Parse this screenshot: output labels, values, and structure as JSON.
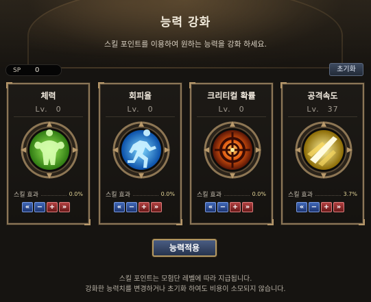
{
  "header": {
    "title": "능력 강화",
    "subtitle": "스킬 포인트를 이용하여 원하는 능력을 강화 하세요."
  },
  "sp": {
    "label": "SP",
    "value": "0"
  },
  "reset_button": "초기화",
  "level_prefix": "Lv.",
  "effect_label": "스킬 효과",
  "cards": [
    {
      "name": "체력",
      "level": "0",
      "effect": "0.0%",
      "icon": "muscle-body-icon",
      "color": "#6fd23a"
    },
    {
      "name": "회피율",
      "level": "0",
      "effect": "0.0%",
      "icon": "running-figure-icon",
      "color": "#2fa8f0"
    },
    {
      "name": "크리티컬 확률",
      "level": "0",
      "effect": "0.0%",
      "icon": "crosshair-target-icon",
      "color": "#f07a1e"
    },
    {
      "name": "공격속도",
      "level": "37",
      "effect": "3.7%",
      "icon": "speed-blade-icon",
      "color": "#f2c62a"
    }
  ],
  "stepper_icons": [
    "double-left-icon",
    "minus-icon",
    "plus-icon",
    "double-right-icon"
  ],
  "apply_button": "능력적용",
  "notice": {
    "line1": "스킬 포인트는 모험단 레벨에 따라 지급됩니다.",
    "line2": "강화한 능력치를 변경하거나 초기화 하여도 비용이 소모되지 않습니다."
  }
}
